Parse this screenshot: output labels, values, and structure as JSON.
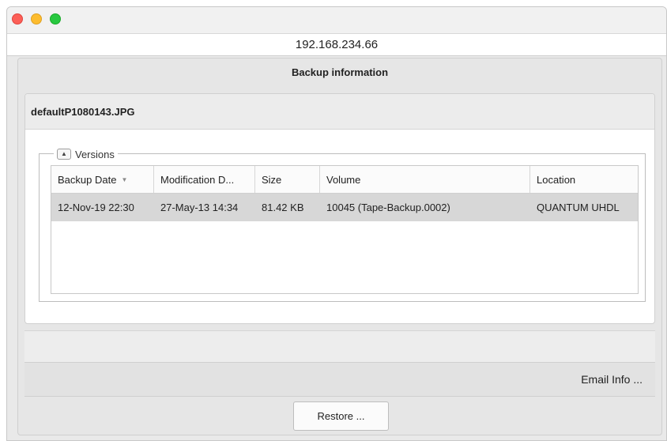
{
  "window": {
    "address": "192.168.234.66",
    "controls": [
      "close",
      "minimize",
      "maximize"
    ]
  },
  "dialog": {
    "title": "Backup information",
    "file_name": "defaultP1080143.JPG",
    "versions": {
      "label": "Versions",
      "collapse_icon": "triangle-up-icon",
      "columns": [
        "Backup Date",
        "Modification D...",
        "Size",
        "Volume",
        "Location"
      ],
      "sort_column": "Backup Date",
      "rows": [
        [
          "12-Nov-19 22:30",
          "27-May-13 14:34",
          "81.42 KB",
          "10045 (Tape-Backup.0002)",
          "QUANTUM UHDL"
        ]
      ]
    },
    "email_info_label": "Email Info ...",
    "restore_label": "Restore ..."
  },
  "colors": {
    "selected_row": "#d7d7d7",
    "close": "#fc5f57",
    "minimize": "#fdbc2e",
    "maximize": "#28c840"
  }
}
